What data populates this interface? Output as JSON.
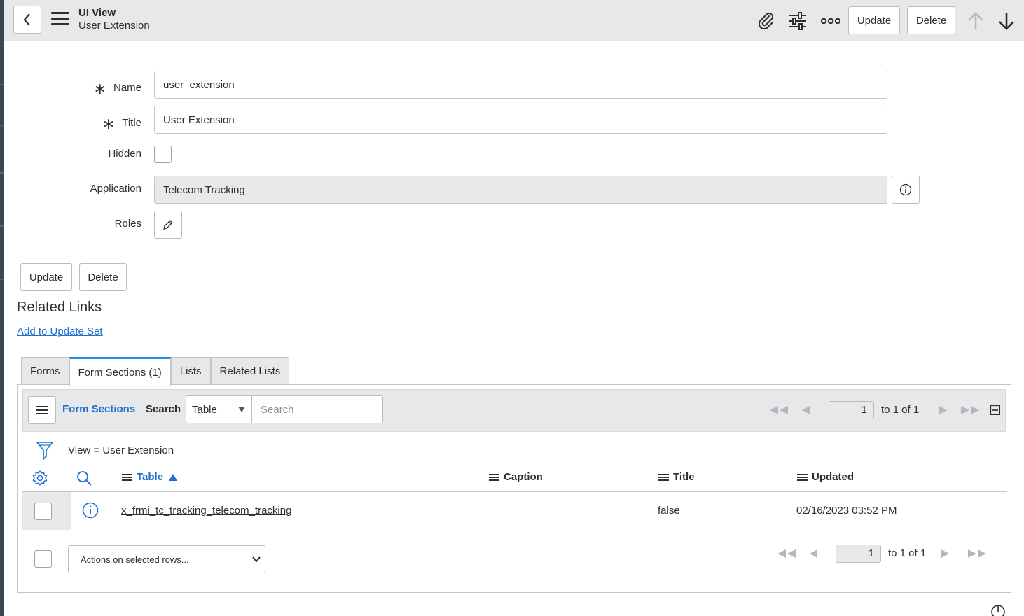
{
  "header": {
    "title": "UI View",
    "subtitle": "User Extension",
    "update_label": "Update",
    "delete_label": "Delete"
  },
  "form": {
    "name_label": "Name",
    "name_value": "user_extension",
    "title_label": "Title",
    "title_value": "User Extension",
    "hidden_label": "Hidden",
    "hidden_checked": false,
    "application_label": "Application",
    "application_value": "Telecom Tracking",
    "roles_label": "Roles",
    "required_mark": "∗"
  },
  "actions": {
    "update_label": "Update",
    "delete_label": "Delete"
  },
  "related_links": {
    "title": "Related Links",
    "add_to_update_set": "Add to Update Set"
  },
  "tabs": [
    {
      "label": "Forms",
      "active": false
    },
    {
      "label": "Form Sections (1)",
      "active": true
    },
    {
      "label": "Lists",
      "active": false
    },
    {
      "label": "Related Lists",
      "active": false
    }
  ],
  "list": {
    "title": "Form Sections",
    "search_label": "Search",
    "search_field": "Table",
    "search_placeholder": "Search",
    "page_value": "1",
    "page_text": "to 1 of 1",
    "filter_text": "View = User Extension",
    "columns": {
      "table": "Table",
      "caption": "Caption",
      "title": "Title",
      "updated": "Updated"
    },
    "rows": [
      {
        "table": "x_frmi_tc_tracking_telecom_tracking",
        "caption": "",
        "title": "false",
        "updated": "02/16/2023 03:52 PM"
      }
    ],
    "actions_select": "Actions on selected rows...",
    "footer_page_value": "1",
    "footer_page_text": "to 1 of 1"
  },
  "colors": {
    "accent": "#1f8ceb",
    "link": "#1f6fd0",
    "header_bg": "#e6e8ea"
  }
}
